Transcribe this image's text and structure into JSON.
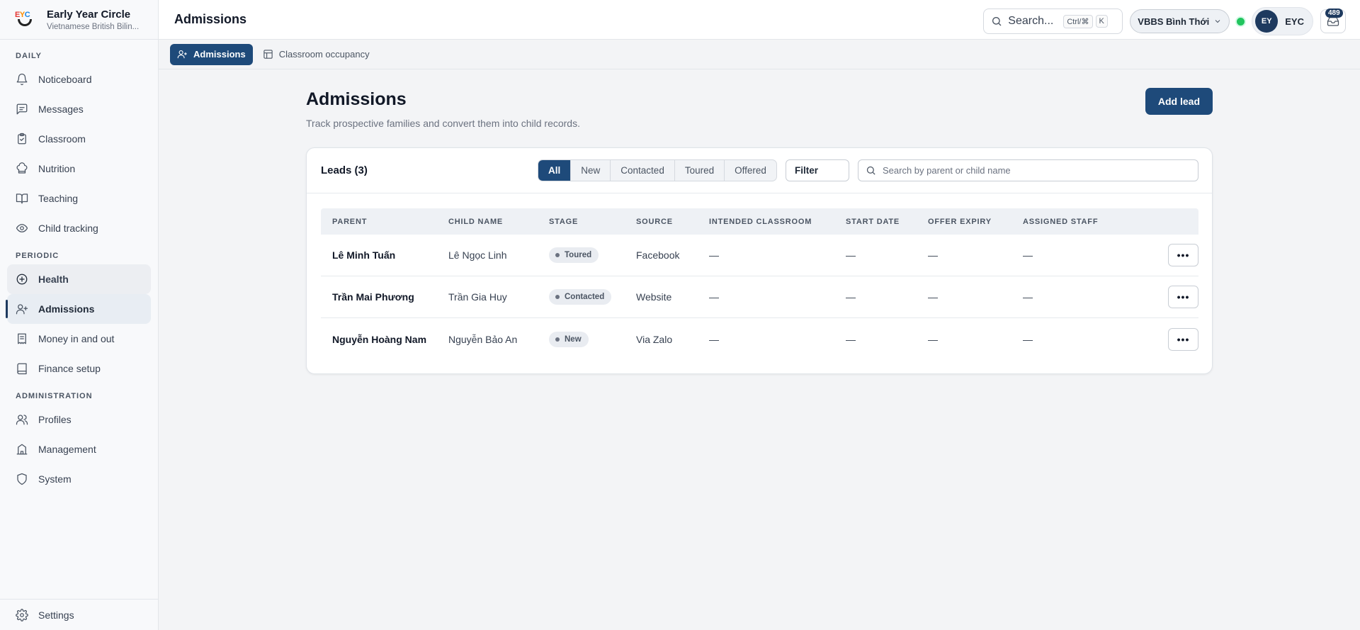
{
  "brand": {
    "logo_text": "EYC",
    "title": "Early Year Circle",
    "subtitle": "Vietnamese British Bilin..."
  },
  "sidebar": {
    "sections": {
      "daily": "DAILY",
      "periodic": "PERIODIC",
      "administration": "ADMINISTRATION"
    },
    "items": [
      {
        "label": "Noticeboard",
        "icon": "bell-icon"
      },
      {
        "label": "Messages",
        "icon": "message-icon"
      },
      {
        "label": "Classroom",
        "icon": "clipboard-icon"
      },
      {
        "label": "Nutrition",
        "icon": "chef-hat-icon"
      },
      {
        "label": "Teaching",
        "icon": "book-open-icon"
      },
      {
        "label": "Child tracking",
        "icon": "eye-icon"
      },
      {
        "label": "Health",
        "icon": "plus-circle-icon"
      },
      {
        "label": "Admissions",
        "icon": "user-plus-icon"
      },
      {
        "label": "Money in and out",
        "icon": "receipt-icon"
      },
      {
        "label": "Finance setup",
        "icon": "book-icon"
      },
      {
        "label": "Profiles",
        "icon": "users-icon"
      },
      {
        "label": "Management",
        "icon": "building-icon"
      },
      {
        "label": "System",
        "icon": "shield-icon"
      }
    ],
    "settings_label": "Settings"
  },
  "topbar": {
    "title": "Admissions",
    "search_label": "Search...",
    "shortcut_mod": "Ctrl/⌘",
    "shortcut_key": "K",
    "site": "VBBS Bình Thới",
    "avatar_initials": "EY",
    "user_name": "EYC",
    "notification_count": "489"
  },
  "subtabs": [
    {
      "label": "Admissions",
      "active": true
    },
    {
      "label": "Classroom occupancy",
      "active": false
    }
  ],
  "page": {
    "title": "Admissions",
    "subtitle": "Track prospective families and convert them into child records.",
    "add_button": "Add lead"
  },
  "leads": {
    "title": "Leads (3)",
    "stage_filters": [
      "All",
      "New",
      "Contacted",
      "Toured",
      "Offered"
    ],
    "active_filter": "All",
    "filter_button": "Filter",
    "search_placeholder": "Search by parent or child name",
    "columns": [
      "PARENT",
      "CHILD NAME",
      "STAGE",
      "SOURCE",
      "INTENDED CLASSROOM",
      "START DATE",
      "OFFER EXPIRY",
      "ASSIGNED STAFF"
    ],
    "rows": [
      {
        "parent": "Lê Minh Tuấn",
        "child": "Lê Ngọc Linh",
        "stage": "Toured",
        "source": "Facebook",
        "classroom": "—",
        "start": "—",
        "expiry": "—",
        "staff": "—",
        "actions": "•••"
      },
      {
        "parent": "Trần Mai Phương",
        "child": "Trần Gia Huy",
        "stage": "Contacted",
        "source": "Website",
        "classroom": "—",
        "start": "—",
        "expiry": "—",
        "staff": "—",
        "actions": "•••"
      },
      {
        "parent": "Nguyễn Hoàng Nam",
        "child": "Nguyễn Bảo An",
        "stage": "New",
        "source": "Via Zalo",
        "classroom": "—",
        "start": "—",
        "expiry": "—",
        "staff": "—",
        "actions": "•••"
      }
    ]
  },
  "colors": {
    "primary": "#1e4a7a",
    "status_online": "#22c55e",
    "sidebar_bg": "#f8f9fb",
    "page_bg": "#f3f4f6"
  }
}
